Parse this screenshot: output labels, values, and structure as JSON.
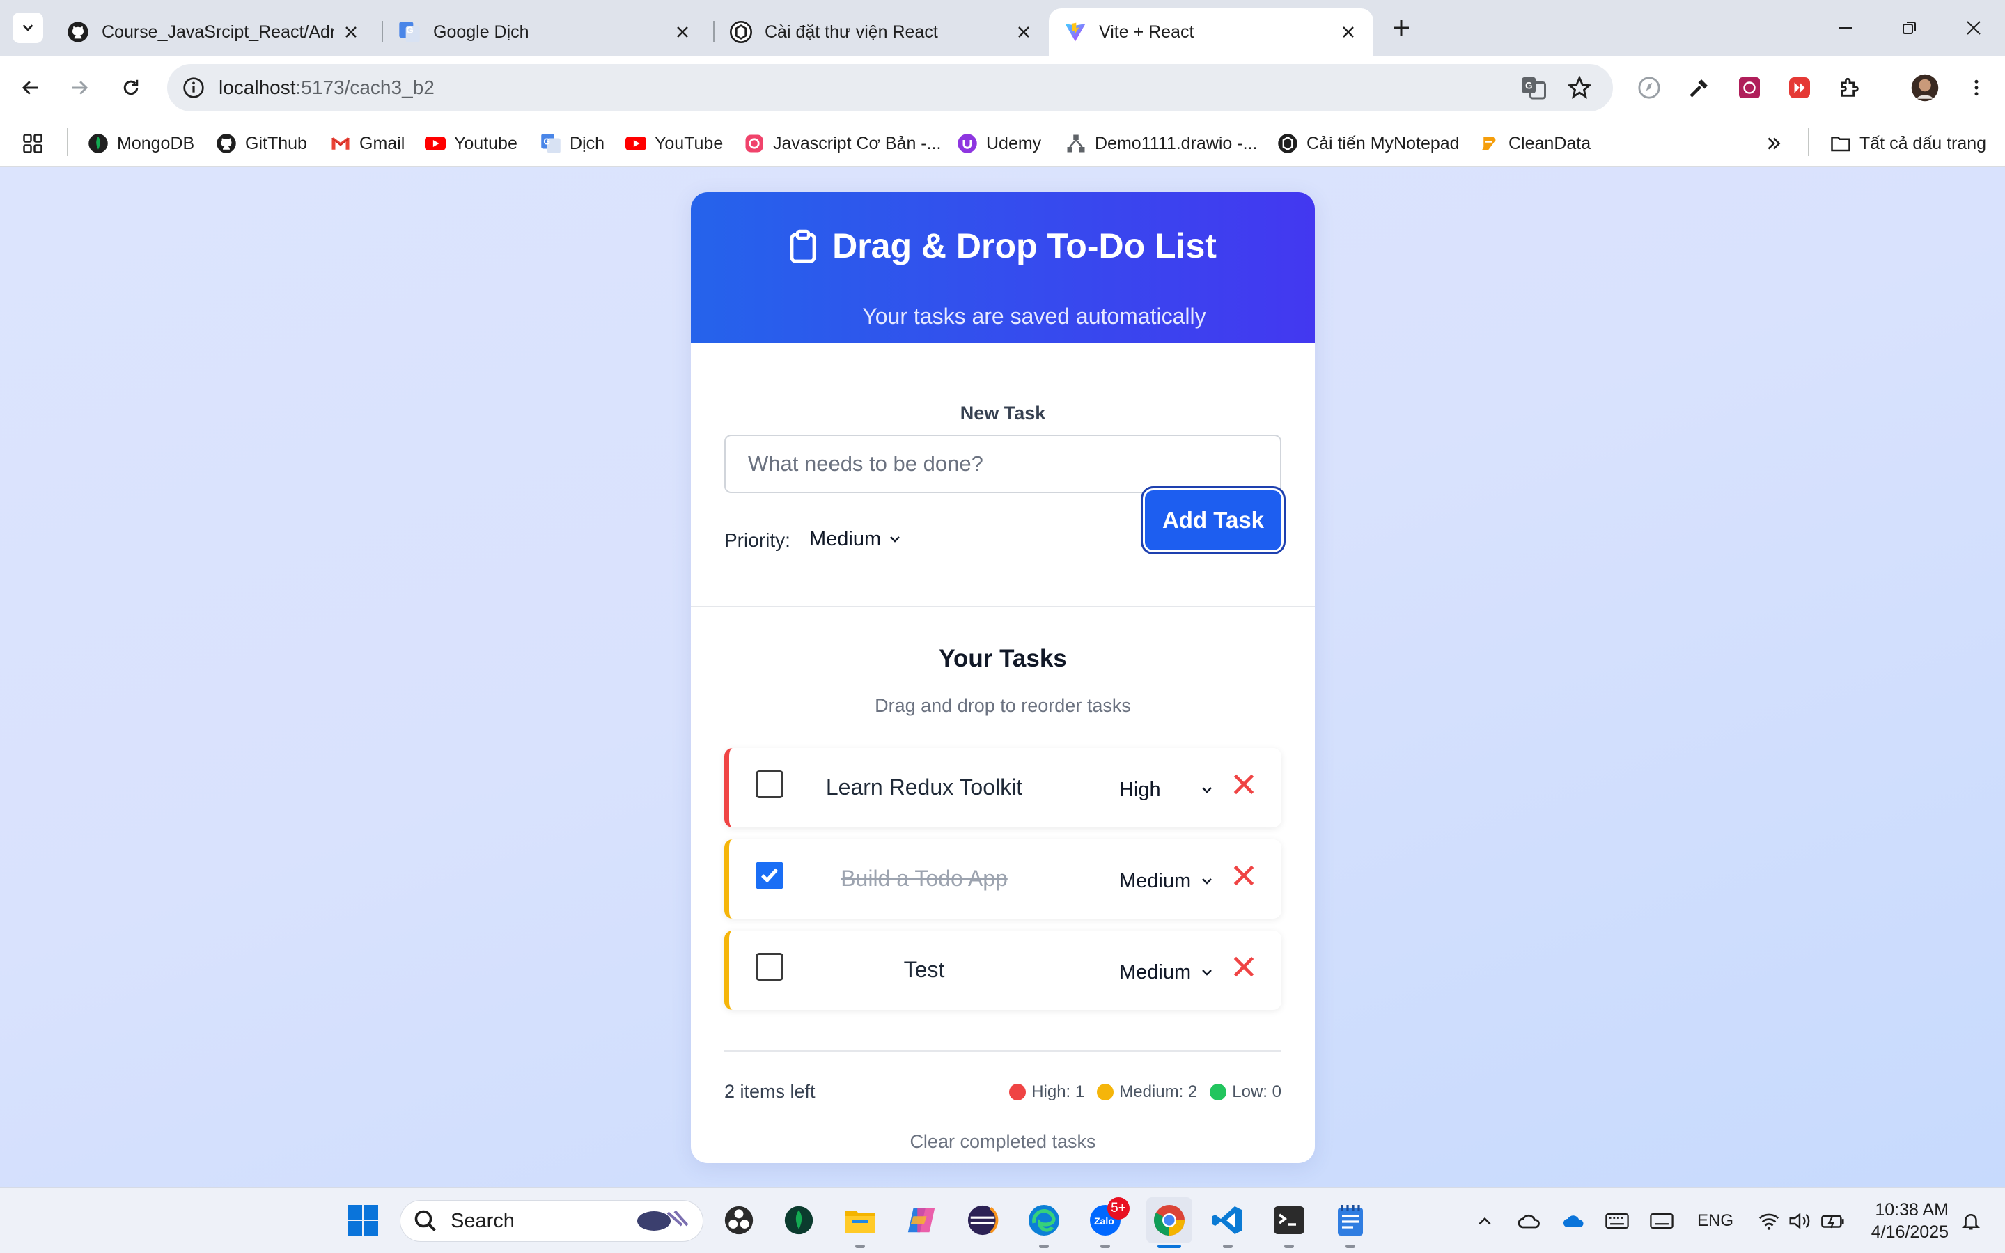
{
  "browser": {
    "tabs": [
      {
        "title": "Course_JavaSrcipt_React/Admin",
        "icon": "github-icon"
      },
      {
        "title": "Google Dịch",
        "icon": "google-translate-icon"
      },
      {
        "title": "Cài đặt thư viện React",
        "icon": "chatgpt-icon"
      },
      {
        "title": "Vite + React",
        "icon": "vite-icon",
        "active": true
      }
    ],
    "url_host": "localhost",
    "url_path": ":5173/cach3_b2",
    "bookmarks": [
      {
        "label": "MongoDB",
        "icon": "mongodb-icon"
      },
      {
        "label": "GitThub",
        "icon": "github-icon"
      },
      {
        "label": "Gmail",
        "icon": "gmail-icon"
      },
      {
        "label": "Youtube",
        "icon": "youtube-icon"
      },
      {
        "label": "Dịch",
        "icon": "google-translate-icon"
      },
      {
        "label": "YouTube",
        "icon": "youtube-icon"
      },
      {
        "label": "Javascript Cơ Bản -...",
        "icon": "course-icon"
      },
      {
        "label": "Udemy",
        "icon": "udemy-icon"
      },
      {
        "label": "Demo1111.drawio -...",
        "icon": "drawio-icon"
      },
      {
        "label": "Cải tiến MyNotepad",
        "icon": "chatgpt-icon"
      },
      {
        "label": "CleanData",
        "icon": "cleandata-icon"
      }
    ],
    "all_bookmarks_label": "Tất cả dấu trang"
  },
  "app": {
    "title": "Drag & Drop To-Do List",
    "subtitle": "Your tasks are saved automatically",
    "new_task_label": "New Task",
    "input_placeholder": "What needs to be done?",
    "input_value": "",
    "priority_label": "Priority:",
    "priority_value": "Medium",
    "add_button": "Add Task",
    "tasks_heading": "Your Tasks",
    "tasks_hint": "Drag and drop to reorder tasks",
    "tasks": [
      {
        "text": "Learn Redux Toolkit",
        "priority": "High",
        "completed": false
      },
      {
        "text": "Build a Todo App",
        "priority": "Medium",
        "completed": true
      },
      {
        "text": "Test",
        "priority": "Medium",
        "completed": false
      }
    ],
    "items_left": "2 items left",
    "counts": {
      "high": "High: 1",
      "medium": "Medium: 2",
      "low": "Low: 0"
    },
    "colors": {
      "high": "#ef4444",
      "medium": "#f5b50a",
      "low": "#22c55e",
      "accent": "#1d5ef0"
    },
    "clear_completed": "Clear completed tasks"
  },
  "taskbar": {
    "search_label": "Search",
    "zalo_badge": "5+",
    "language": "ENG",
    "time": "10:38 AM",
    "date": "4/16/2025"
  }
}
